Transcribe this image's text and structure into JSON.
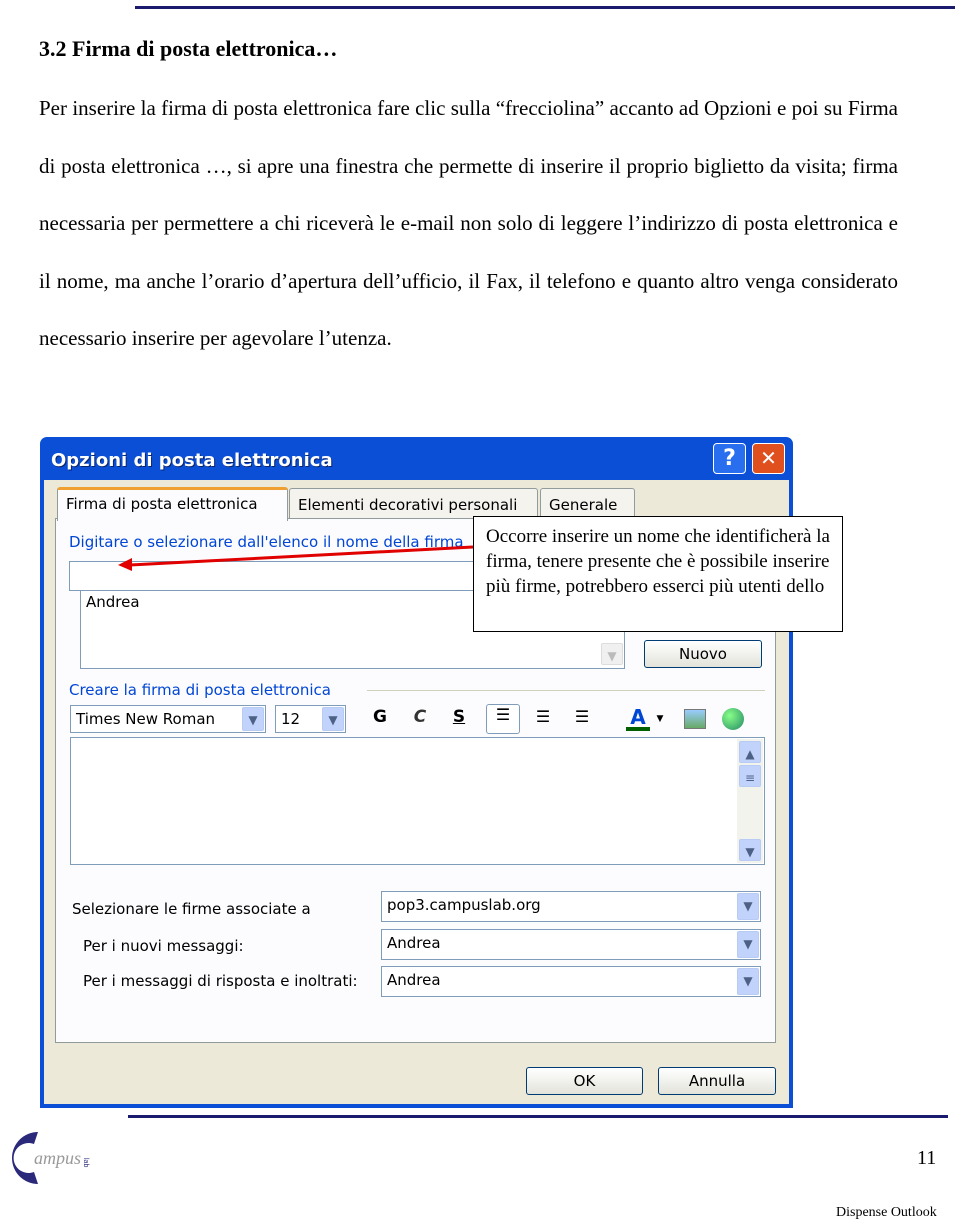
{
  "heading": "3.2 Firma di posta elettronica…",
  "paragraph": "Per inserire la firma di posta elettronica fare clic sulla “frecciolina” accanto ad Opzioni e poi su Firma di posta elettronica …, si apre una finestra che permette di inserire il proprio biglietto da visita; firma necessaria per permettere a chi riceverà le e-mail non solo di leggere l’indirizzo di posta elettronica e il nome, ma anche l’orario d’apertura dell’ufficio, il Fax, il telefono e quanto altro venga considerato necessario inserire per agevolare l’utenza.",
  "dialog": {
    "title": "Opzioni di posta elettronica",
    "help": "?",
    "close": "✕",
    "tabs": [
      "Firma di posta elettronica",
      "Elementi decorativi personali",
      "Generale"
    ],
    "name_label": "Digitare o selezionare dall'elenco il nome della firma",
    "name_value": "",
    "list_items": [
      "Andrea"
    ],
    "new_button": "Nuovo",
    "create_label": "Creare la firma di posta elettronica",
    "font": "Times New Roman",
    "size": "12",
    "bold": "G",
    "italic": "C",
    "underline": "S",
    "font_color_glyph": "A",
    "text_area": "",
    "assoc_label": "Selezionare le firme associate a",
    "assoc_value": "pop3.campuslab.org",
    "new_msg_label": "Per i nuovi messaggi:",
    "new_msg_value": "Andrea",
    "reply_label": "Per i messaggi di risposta e inoltrati:",
    "reply_value": "Andrea",
    "ok": "OK",
    "cancel": "Annulla"
  },
  "callout": "Occorre inserire un nome che identificherà la firma, tenere presente che è possibile inserire più firme, potrebbero esserci più utenti dello",
  "footer": {
    "logo": "campus lab",
    "page_number": "11",
    "doc_title": "Dispense Outlook"
  },
  "colors": {
    "rule": "#1a1a6e",
    "titlebar": "#0a4fd6",
    "arrow": "#e00000"
  }
}
